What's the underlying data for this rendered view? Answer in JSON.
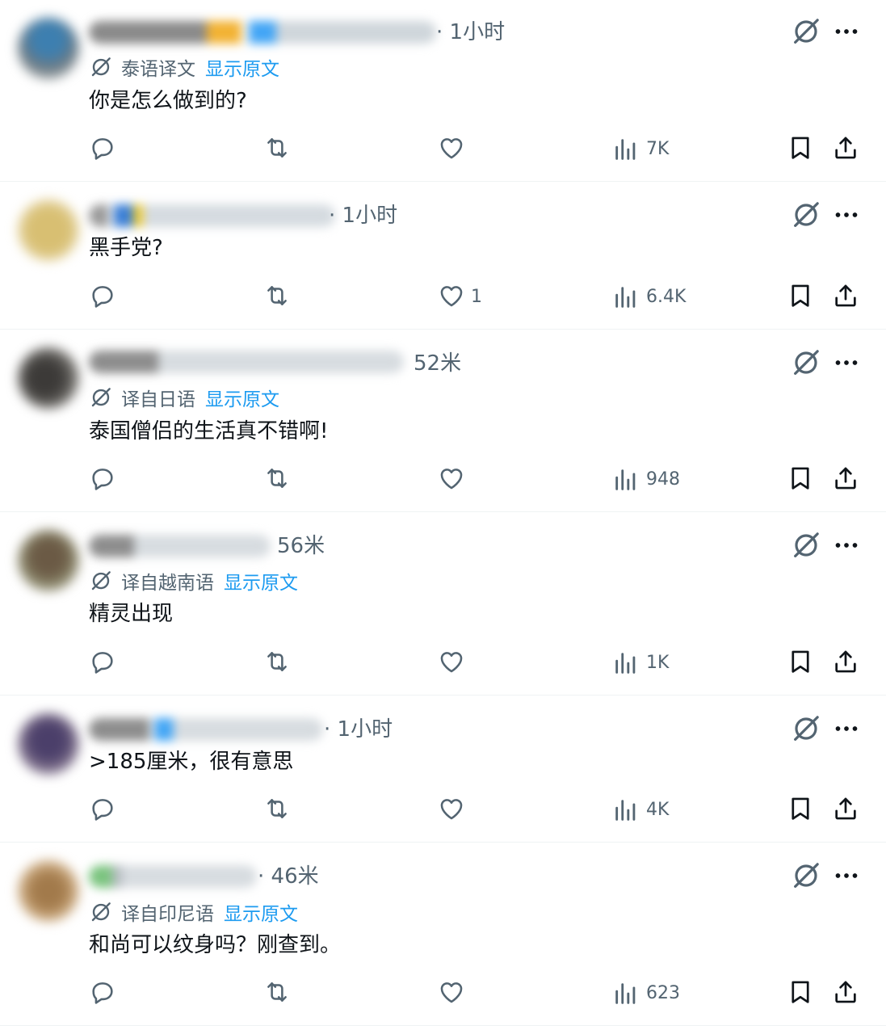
{
  "posts": [
    {
      "time": "· 1小时",
      "translation": "泰语译文",
      "show_original": "显示原文",
      "text": "你是怎么做到的?",
      "likes": "",
      "views": "7K"
    },
    {
      "time": "· 1小时",
      "translation": "",
      "show_original": "",
      "text": "黑手党?",
      "likes": "1",
      "views": "6.4K"
    },
    {
      "time": "52米",
      "translation": "译自日语",
      "show_original": "显示原文",
      "text": "泰国僧侣的生活真不错啊!",
      "likes": "",
      "views": "948"
    },
    {
      "time": "56米",
      "translation": "译自越南语",
      "show_original": "显示原文",
      "text": "精灵出现",
      "likes": "",
      "views": "1K"
    },
    {
      "time": "· 1小时",
      "translation": "",
      "show_original": "",
      "text": ">185厘米，很有意思",
      "likes": "",
      "views": "4K"
    },
    {
      "time": "· 46米",
      "translation": "译自印尼语",
      "show_original": "显示原文",
      "text": "和尚可以纹身吗？刚查到。",
      "likes": "",
      "views": "623"
    }
  ],
  "colors": {
    "text": "#0f1419",
    "secondary": "#536471",
    "link": "#1d9bf0",
    "divider": "#eff3f4"
  },
  "icons": {
    "reply": "reply-icon",
    "repost": "repost-icon",
    "like": "like-icon",
    "views": "views-icon",
    "bookmark": "bookmark-icon",
    "share": "share-icon",
    "grok": "grok-icon",
    "more": "more-icon",
    "translate": "translate-icon"
  }
}
